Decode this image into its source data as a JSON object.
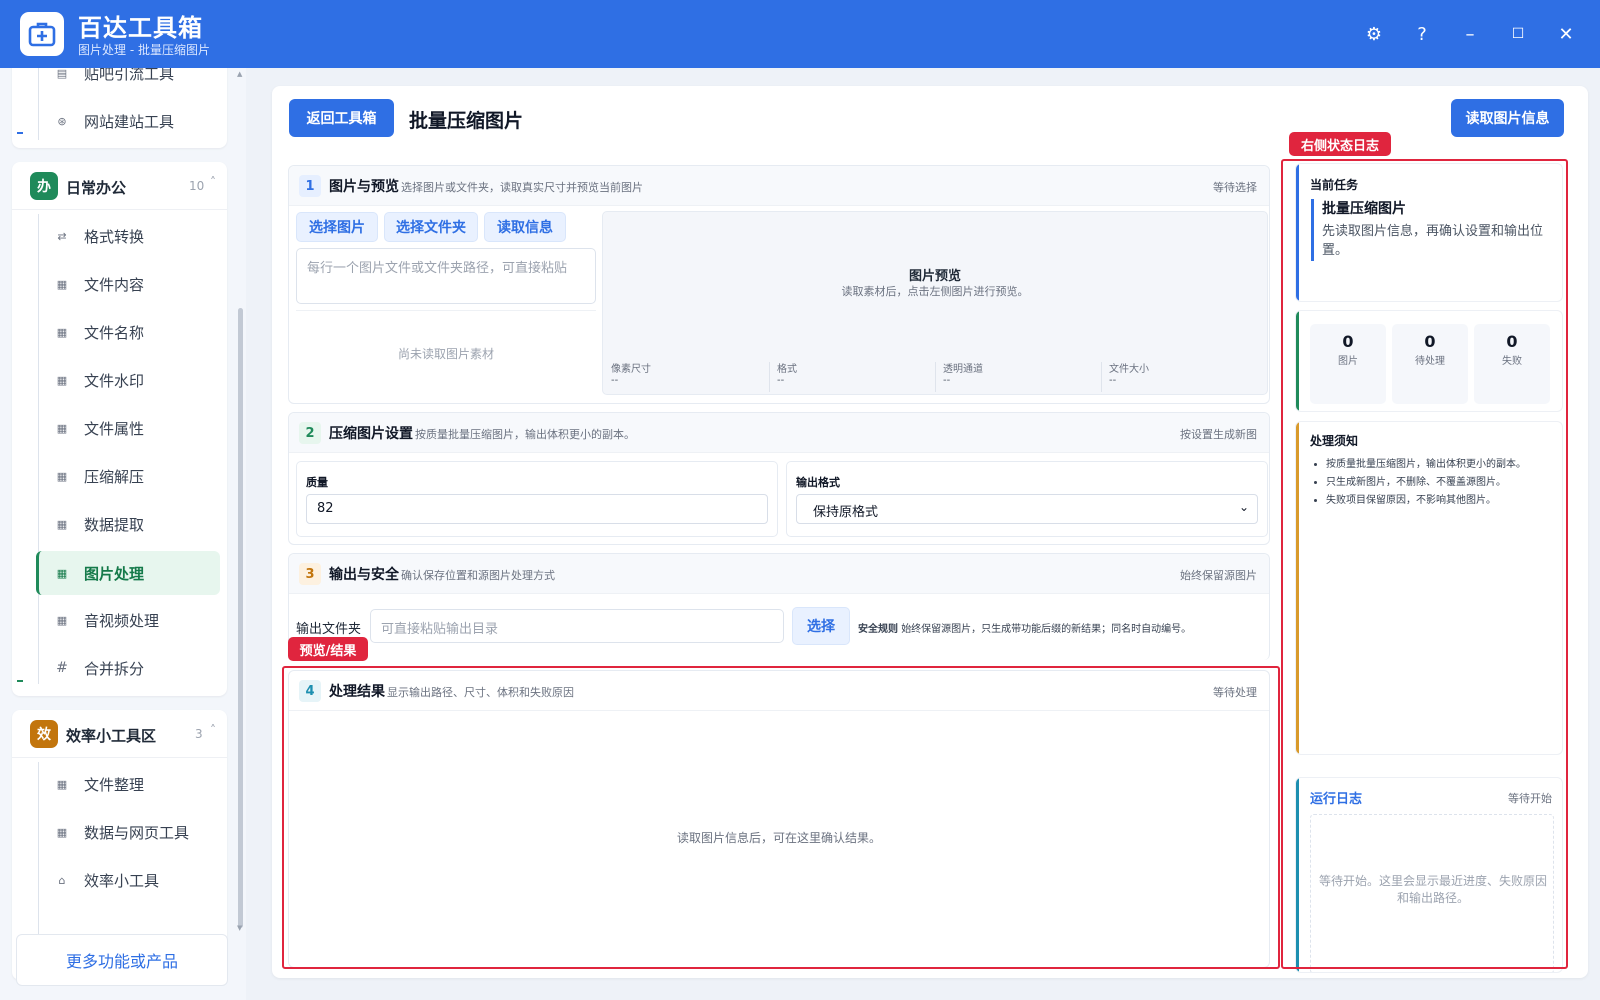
{
  "app": {
    "name": "百达工具箱",
    "subtitle": "图片处理 - 批量压缩图片"
  },
  "window_controls": {
    "settings": "⚙",
    "help": "?",
    "minimize": "–",
    "maximize": "☐",
    "close": "✕"
  },
  "sidebar": {
    "top_items": [
      {
        "label": "贴吧引流工具",
        "icon": "▤"
      },
      {
        "label": "网站建站工具",
        "icon": "⊛"
      }
    ],
    "categories": [
      {
        "badge": "办",
        "title": "日常办公",
        "count": "10",
        "color": "#1f8a5a",
        "items": [
          {
            "label": "格式转换",
            "icon": "⇄"
          },
          {
            "label": "文件内容",
            "icon": "▦"
          },
          {
            "label": "文件名称",
            "icon": "▦"
          },
          {
            "label": "文件水印",
            "icon": "▦"
          },
          {
            "label": "文件属性",
            "icon": "▦"
          },
          {
            "label": "压缩解压",
            "icon": "▦"
          },
          {
            "label": "数据提取",
            "icon": "▦"
          },
          {
            "label": "图片处理",
            "icon": "▦"
          },
          {
            "label": "音视频处理",
            "icon": "▦"
          },
          {
            "label": "合并拆分",
            "icon": "#"
          }
        ]
      },
      {
        "badge": "效",
        "title": "效率小工具区",
        "count": "3",
        "color": "#c2750d",
        "items": [
          {
            "label": "文件整理",
            "icon": "▦"
          },
          {
            "label": "数据与网页工具",
            "icon": "▦"
          },
          {
            "label": "效率小工具",
            "icon": "⌂"
          }
        ]
      }
    ],
    "more_button": "更多功能或产品"
  },
  "header": {
    "back_button": "返回工具箱",
    "page_title": "批量压缩图片",
    "read_info_button": "读取图片信息"
  },
  "section1": {
    "num": "1",
    "title": "图片与预览",
    "desc": "选择图片或文件夹，读取真实尺寸并预览当前图片",
    "status": "等待选择",
    "buttons": {
      "select_image": "选择图片",
      "select_folder": "选择文件夹",
      "read_info": "读取信息"
    },
    "paths_placeholder": "每行一个图片文件或文件夹路径，可直接粘贴",
    "empty_text": "尚未读取图片素材",
    "preview": {
      "title": "图片预览",
      "hint": "读取素材后，点击左侧图片进行预览。",
      "fields": [
        {
          "label": "像素尺寸",
          "value": "--"
        },
        {
          "label": "格式",
          "value": "--"
        },
        {
          "label": "透明通道",
          "value": "--"
        },
        {
          "label": "文件大小",
          "value": "--"
        }
      ]
    }
  },
  "section2": {
    "num": "2",
    "title": "压缩图片设置",
    "desc": "按质量批量压缩图片，输出体积更小的副本。",
    "status": "按设置生成新图",
    "quality_label": "质量",
    "quality_value": "82",
    "format_label": "输出格式",
    "format_value": "保持原格式"
  },
  "section3": {
    "num": "3",
    "title": "输出与安全",
    "desc": "确认保存位置和源图片处理方式",
    "status": "始终保留源图片",
    "output_label": "输出文件夹",
    "output_placeholder": "可直接粘贴输出目录",
    "select_button": "选择",
    "safety_label": "安全规则",
    "safety_text": "始终保留源图片，只生成带功能后缀的新结果；同名时自动编号。"
  },
  "section4": {
    "num": "4",
    "title": "处理结果",
    "desc": "显示输出路径、尺寸、体积和失败原因",
    "status": "等待处理",
    "empty_text": "读取图片信息后，可在这里确认结果。"
  },
  "right_panel": {
    "current_task": {
      "heading": "当前任务",
      "title": "批量压缩图片",
      "desc": "先读取图片信息，再确认设置和输出位置。"
    },
    "stats": [
      {
        "num": "0",
        "label": "图片"
      },
      {
        "num": "0",
        "label": "待处理"
      },
      {
        "num": "0",
        "label": "失败"
      }
    ],
    "notes": {
      "heading": "处理须知",
      "items": [
        "按质量批量压缩图片，输出体积更小的副本。",
        "只生成新图片，不删除、不覆盖源图片。",
        "失败项目保留原因，不影响其他图片。"
      ]
    },
    "log": {
      "title": "运行日志",
      "status": "等待开始",
      "empty": "等待开始。这里会显示最近进度、失败原因和输出路径。"
    }
  },
  "annotations": {
    "right_log": "右侧状态日志",
    "preview_result": "预览/结果"
  },
  "colors": {
    "primary": "#2f6fe4",
    "green": "#1f8a5a",
    "orange": "#c2750d",
    "red": "#e0253e"
  }
}
